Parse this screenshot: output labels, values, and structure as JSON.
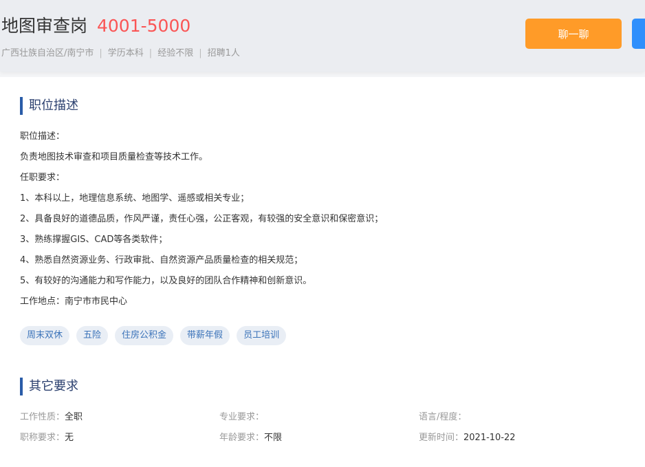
{
  "header": {
    "title": "地图审查岗",
    "salary": "4001-5000",
    "meta": [
      "广西壮族自治区/南宁市",
      "学历本科",
      "经验不限",
      "招聘1人"
    ],
    "chat_label": "聊一聊"
  },
  "description": {
    "section_title": "职位描述",
    "lines": [
      "职位描述：",
      "负责地图技术审查和项目质量检查等技术工作。",
      "任职要求：",
      "1、本科以上，地理信息系统、地图学、遥感或相关专业；",
      "2、具备良好的道德品质，作风严谨，责任心强，公正客观，有较强的安全意识和保密意识；",
      "3、熟练撑握GIS、CAD等各类软件；",
      "4、熟悉自然资源业务、行政审批、自然资源产品质量检查的相关规范；",
      "5、有较好的沟通能力和写作能力，以及良好的团队合作精神和创新意识。",
      "工作地点：南宁市市民中心"
    ],
    "tags": [
      "周末双休",
      "五险",
      "住房公积金",
      "带薪年假",
      "员工培训"
    ]
  },
  "other": {
    "section_title": "其它要求",
    "rows": [
      [
        {
          "key": "工作性质：",
          "value": "全职"
        },
        {
          "key": "专业要求：",
          "value": ""
        },
        {
          "key": "语言/程度：",
          "value": ""
        }
      ],
      [
        {
          "key": "职称要求：",
          "value": "无"
        },
        {
          "key": "年龄要求：",
          "value": "不限"
        },
        {
          "key": "更新时间：",
          "value": "2021-10-22"
        }
      ]
    ]
  },
  "colors": {
    "salary": "#fa5555",
    "chat_button": "#ff9b28",
    "apply_button": "#2f8ffc",
    "accent": "#2a5ca8",
    "tag_text": "#3b73b9"
  }
}
